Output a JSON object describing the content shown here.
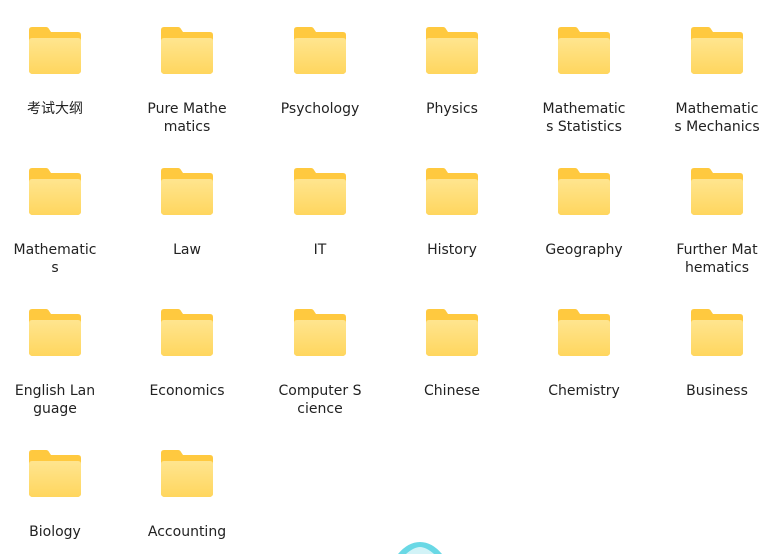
{
  "folders": [
    {
      "label": "考试大纲"
    },
    {
      "label": "Pure Mathematics"
    },
    {
      "label": "Psychology"
    },
    {
      "label": "Physics"
    },
    {
      "label": "Mathematics Statistics"
    },
    {
      "label": "Mathematics Mechanics"
    },
    {
      "label": "Mathematics"
    },
    {
      "label": "Law"
    },
    {
      "label": "IT"
    },
    {
      "label": "History"
    },
    {
      "label": "Geography"
    },
    {
      "label": "Further Mathematics"
    },
    {
      "label": "English Language"
    },
    {
      "label": "Economics"
    },
    {
      "label": "Computer Science"
    },
    {
      "label": "Chinese"
    },
    {
      "label": "Chemistry"
    },
    {
      "label": "Business"
    },
    {
      "label": "Biology"
    },
    {
      "label": "Accounting"
    }
  ],
  "colors": {
    "folder_back": "#FFC93F",
    "folder_front_top": "#FFE48C",
    "folder_front_bottom": "#FFD35A",
    "label_text": "#222222",
    "partial_icon": "#4FD1E0"
  }
}
